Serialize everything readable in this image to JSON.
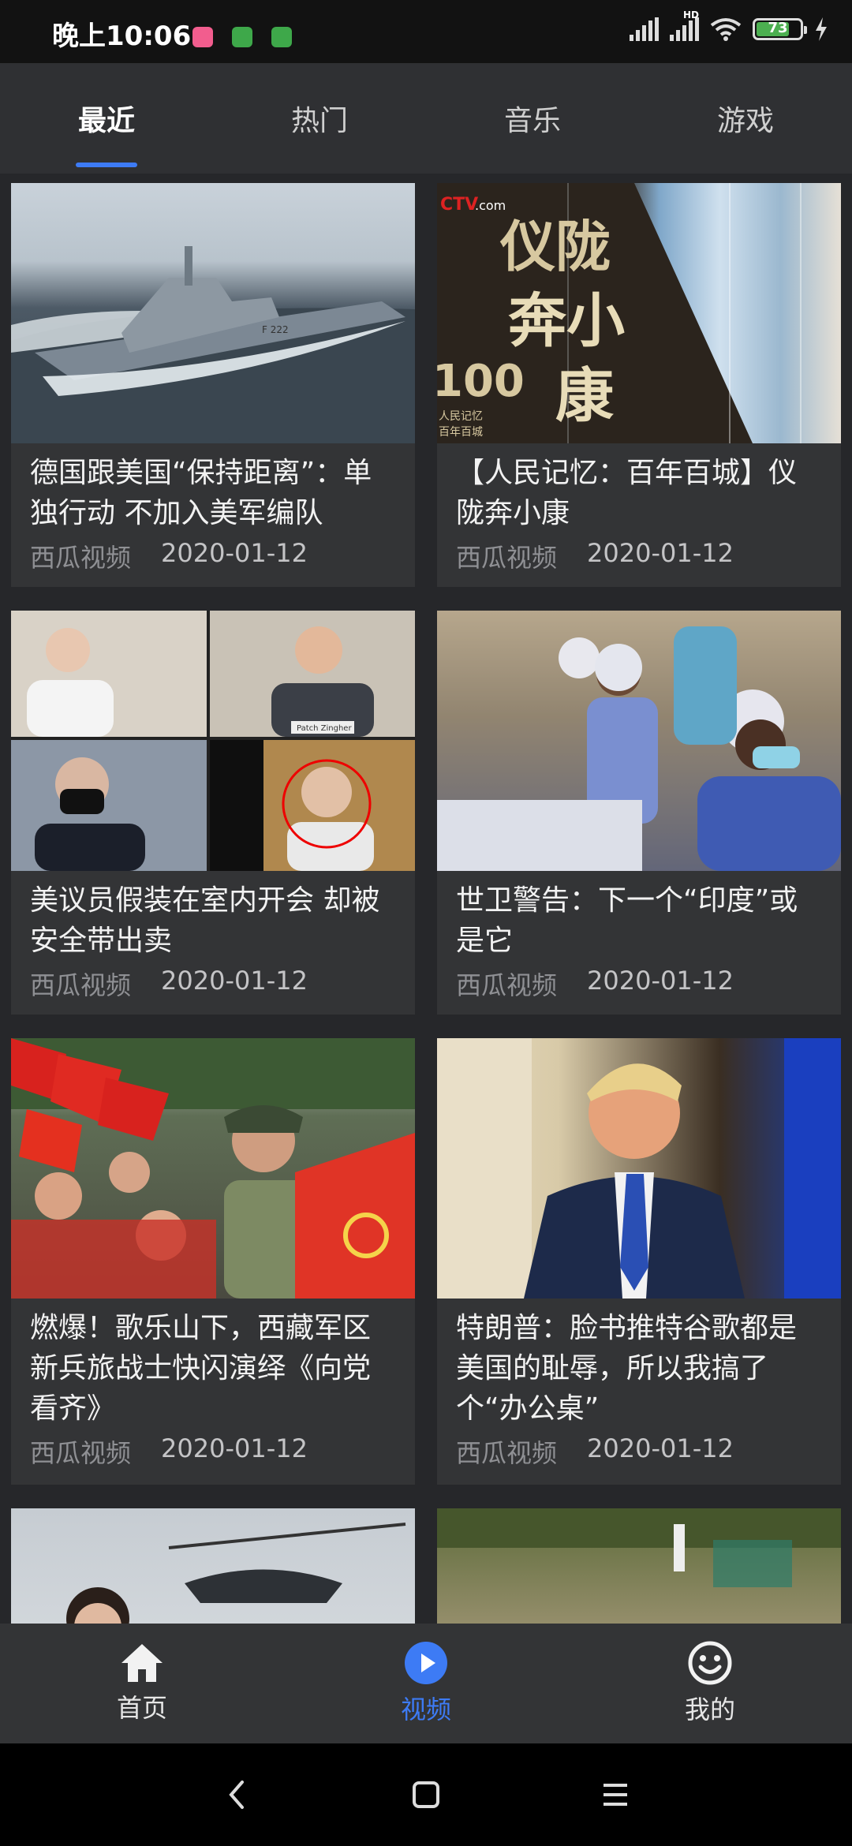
{
  "status_bar": {
    "time": "晚上10:06",
    "network": "HD",
    "battery": "73"
  },
  "tabs": [
    {
      "label": "最近",
      "active": true
    },
    {
      "label": "热门",
      "active": false
    },
    {
      "label": "音乐",
      "active": false
    },
    {
      "label": "游戏",
      "active": false
    }
  ],
  "feed": {
    "items": [
      {
        "title": "德国跟美国“保持距离”：单独行动 不加入美军编队",
        "source": "西瓜视频",
        "date": "2020-01-12"
      },
      {
        "title": "【人民记忆：百年百城】仪陇奔小康",
        "source": "西瓜视频",
        "date": "2020-01-12"
      },
      {
        "title": "美议员假装在室内开会 却被安全带出卖",
        "source": "西瓜视频",
        "date": "2020-01-12"
      },
      {
        "title": "世卫警告：下一个“印度”或是它",
        "source": "西瓜视频",
        "date": "2020-01-12"
      },
      {
        "title": "燃爆！歌乐山下，西藏军区新兵旅战士快闪演绎《向党看齐》",
        "source": "西瓜视频",
        "date": "2020-01-12"
      },
      {
        "title": "特朗普：脸书推特谷歌都是美国的耻辱，所以我搞了个“办公桌”",
        "source": "西瓜视频",
        "date": "2020-01-12"
      }
    ],
    "thumb_text": {
      "cctv": "CTV",
      "cctv_sub": ".com",
      "hundred": "100",
      "mem1": "人民记忆",
      "mem2": "百年百城",
      "calli1": "仪陇",
      "calli2": "奔小",
      "calli3": "康",
      "hull": "F 222",
      "nameplate": "Patch Zingher"
    }
  },
  "bottom_nav": [
    {
      "label": "首页",
      "icon": "home-icon",
      "active": false
    },
    {
      "label": "视频",
      "icon": "play-icon",
      "active": true
    },
    {
      "label": "我的",
      "icon": "smile-icon",
      "active": false
    }
  ],
  "colors": {
    "accent": "#3d7bf5",
    "background": "#2b2c2e",
    "card": "#333436"
  }
}
